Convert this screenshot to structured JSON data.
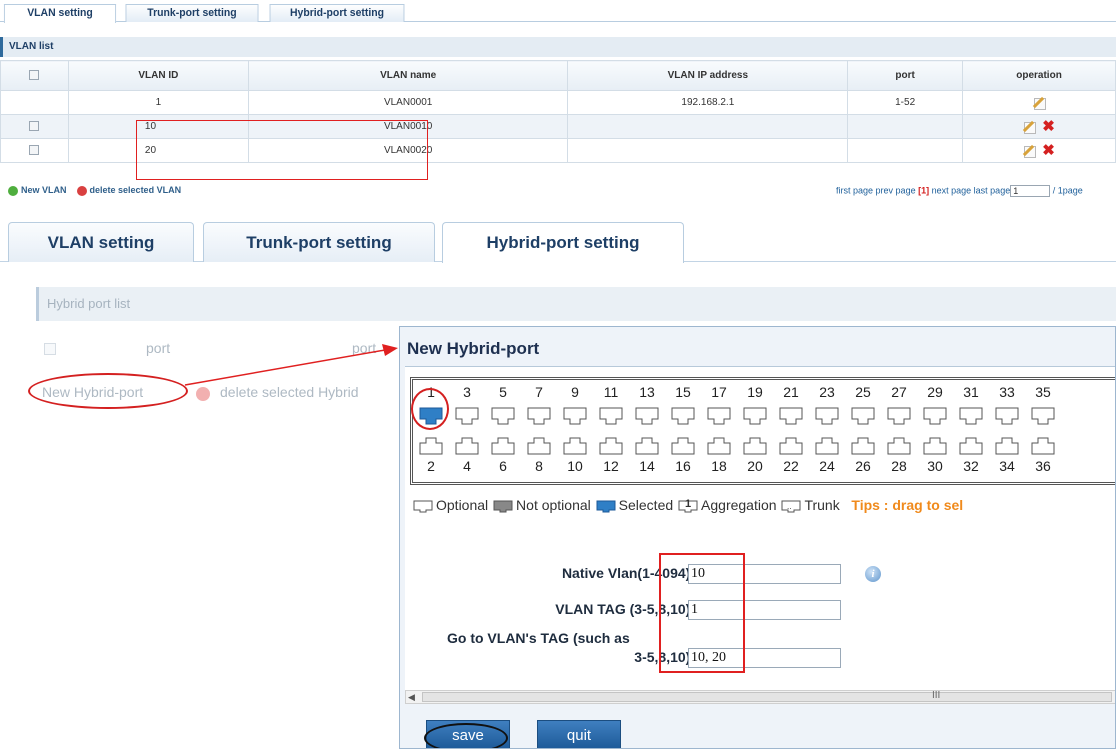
{
  "top_tabs": [
    {
      "label": "VLAN setting",
      "active": true
    },
    {
      "label": "Trunk-port setting",
      "active": false
    },
    {
      "label": "Hybrid-port setting",
      "active": false
    }
  ],
  "vlan_list": {
    "title": "VLAN list",
    "columns": [
      "VLAN ID",
      "VLAN name",
      "VLAN IP address",
      "port",
      "operation"
    ],
    "rows": [
      {
        "id": "1",
        "name": "VLAN0001",
        "ip": "192.168.2.1",
        "port": "1-52",
        "checkbox": false,
        "deletable": false
      },
      {
        "id": "10",
        "name": "VLAN0010",
        "ip": "",
        "port": "",
        "checkbox": true,
        "deletable": true
      },
      {
        "id": "20",
        "name": "VLAN0020",
        "ip": "",
        "port": "",
        "checkbox": true,
        "deletable": true
      }
    ],
    "new_label": "New VLAN",
    "delete_label": "delete selected VLAN",
    "pager": {
      "first": "first page",
      "prev": "prev page",
      "current": "[1]",
      "next": "next page",
      "last": "last page",
      "input_value": "1",
      "total": "/ 1page"
    }
  },
  "big_tabs": [
    {
      "label": "VLAN setting",
      "active": false
    },
    {
      "label": "Trunk-port setting",
      "active": false
    },
    {
      "label": "Hybrid-port setting",
      "active": true
    }
  ],
  "hybrid": {
    "title": "Hybrid port list",
    "col_port": "port",
    "col_port_partial": "port",
    "new_label": "New Hybrid-port",
    "delete_label": "delete selected Hybrid"
  },
  "dialog": {
    "title": "New Hybrid-port",
    "top_ports": [
      "1",
      "3",
      "5",
      "7",
      "9",
      "11",
      "13",
      "15",
      "17",
      "19",
      "21",
      "23",
      "25",
      "27",
      "29",
      "31",
      "33",
      "35"
    ],
    "bottom_ports": [
      "2",
      "4",
      "6",
      "8",
      "10",
      "12",
      "14",
      "16",
      "18",
      "20",
      "22",
      "24",
      "26",
      "28",
      "30",
      "32",
      "34",
      "36"
    ],
    "selected_port": "1",
    "legend": {
      "optional": "Optional",
      "not_optional": "Not optional",
      "selected": "Selected",
      "aggregation_num": "1",
      "aggregation": "Aggregation",
      "trunk": "Trunk",
      "tips": "Tips : drag to sel"
    },
    "native_vlan_label": "Native Vlan(1-4094):",
    "native_vlan_value": "10",
    "vlan_tag_label": "VLAN TAG (3-5,8,10):",
    "vlan_tag_value": "1",
    "goto_tag_label_1": "Go to VLAN's TAG (such as",
    "goto_tag_label_2": "3-5,8,10):",
    "goto_tag_value": "10, 20",
    "scroll_marker": "III",
    "save_label": "save",
    "quit_label": "quit"
  },
  "colors": {
    "accent": "#1d5a98",
    "annotation": "#e02020",
    "tips": "#f08a1c",
    "selected_port": "#2f7fc6"
  }
}
